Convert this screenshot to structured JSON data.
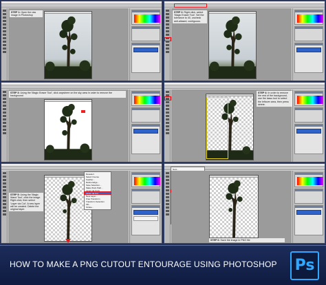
{
  "panels": [
    {
      "id": "step1",
      "step_label": "STEP 1:",
      "step_text": "Open the raw image in Photoshop"
    },
    {
      "id": "step2",
      "step_label": "STEP 2:",
      "step_text": "Right click, select 'Magic Eraser Tool'. Set the tolerance to 40, uncheck anti-aliased, contiguous."
    },
    {
      "id": "step3",
      "step_label": "STEP 3:",
      "step_text": "Using the 'Magic Eraser Tool', click anywhere on the sky area in order to remove the background"
    },
    {
      "id": "step4",
      "step_label": "STEP 4:",
      "step_text": "In order to remove the rest of the background, use the lasso tool to select the leftover area, then press delete."
    },
    {
      "id": "step5",
      "step_label": "STEP 5:",
      "step_text": "Using the 'Magic Wand Tool', click the image. Right click, then select 'Layer via Cut'. A new layer will be created. Delete the original layer."
    },
    {
      "id": "step6",
      "step_label": "STEP 6:",
      "step_text": "Save the image in PNG file"
    }
  ],
  "step5_menu": [
    "Deselect",
    "Select Inverse",
    "Feather...",
    "Refine Edge...",
    "Save Selection...",
    "Make Work Path...",
    "Layer via Copy",
    "Layer via Cut",
    "New Layer...",
    "Free Transform",
    "Transform Selection",
    "Fill...",
    "Stroke..."
  ],
  "step5_menu_highlight": "Layer via Cut",
  "step6_menu": [
    "New...",
    "Open...",
    "Browse in Bridge...",
    "Open As...",
    "Open Recent",
    "Close",
    "Close All",
    "Save",
    "Save As...",
    "Check In...",
    "Save for Web & Devices...",
    "Revert",
    "Place...",
    "Import",
    "Export",
    "Automate",
    "Scripts",
    "File Info...",
    "Print...",
    "Exit"
  ],
  "step6_menu_highlight": "Save As...",
  "banner": {
    "title": "HOW TO MAKE A PNG CUTOUT ENTOURAGE USING PHOTOSHOP",
    "logo_text": "Ps"
  },
  "colors": {
    "highlight_red": "#e8131a",
    "highlight_yellow": "#e7d21a",
    "banner_bg": "#0f1b40",
    "photoshop_blue": "#31a8ff"
  }
}
